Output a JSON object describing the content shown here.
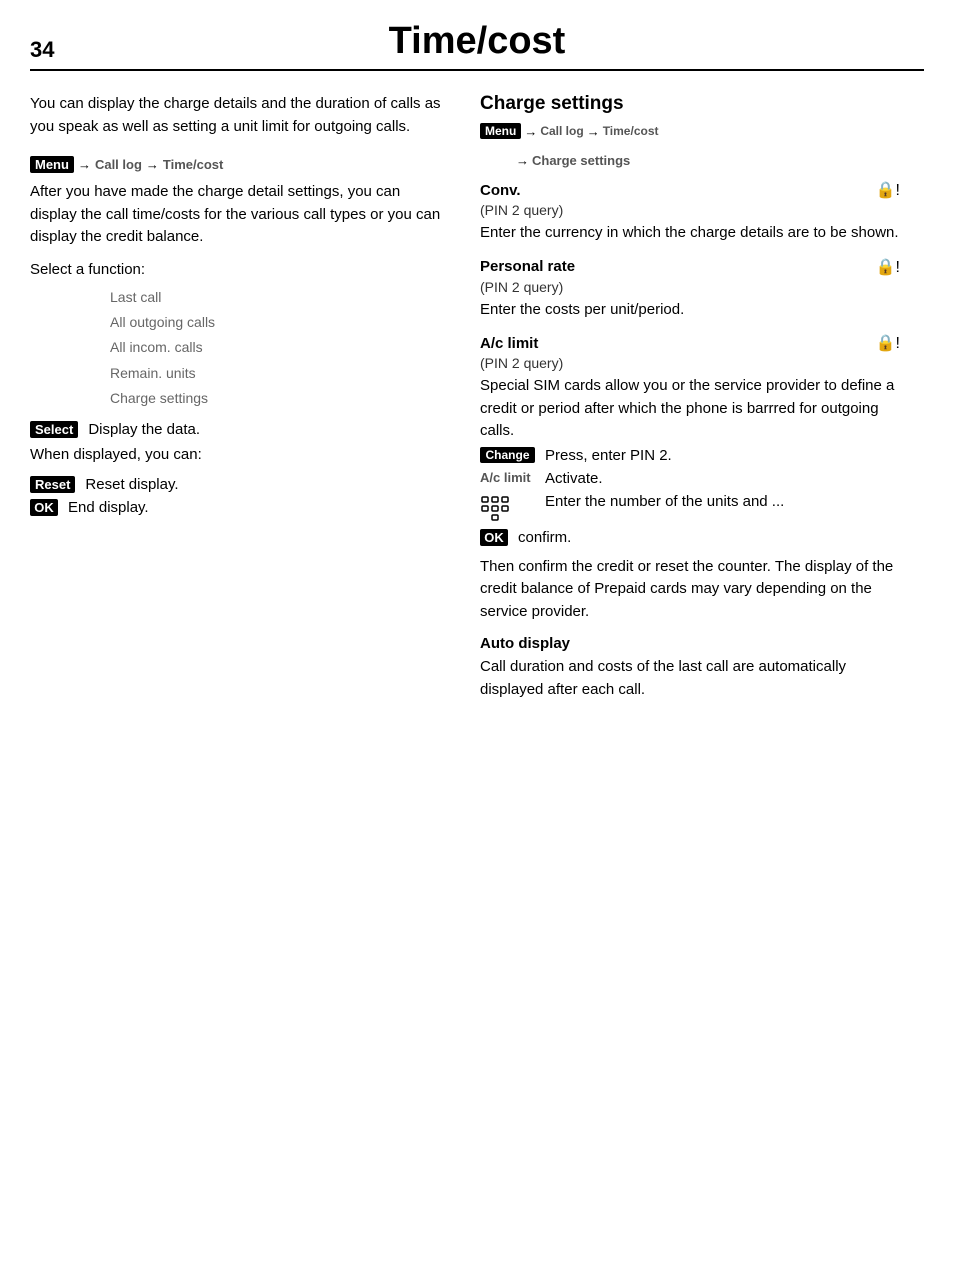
{
  "header": {
    "page_number": "34",
    "title": "Time/cost"
  },
  "left": {
    "intro": "You can display the charge details and the duration of calls as you speak as well as setting a unit limit for outgoing calls.",
    "nav": {
      "menu_label": "Menu",
      "arrow1": "→",
      "call_log": "Call log",
      "arrow2": "→",
      "time_cost": "Time/cost"
    },
    "after_text": "After you have made the charge detail settings, you can display the call time/costs for the various call types or you can display the credit balance.",
    "select_function": "Select a function:",
    "functions": [
      "Last call",
      "All outgoing calls",
      "All incom. calls",
      "Remain. units",
      "Charge settings"
    ],
    "select_btn": "Select",
    "select_action": "Display the data.",
    "when_displayed": "When displayed, you can:",
    "reset_btn": "Reset",
    "reset_action": "Reset display.",
    "ok_btn": "OK",
    "ok_action": "End display."
  },
  "right": {
    "charge_settings_title": "Charge settings",
    "nav": {
      "menu_label": "Menu",
      "arrow1": "→",
      "call_log": "Call log",
      "arrow2": "→",
      "time_cost": "Time/cost",
      "arrow3": "→",
      "charge_settings": "Charge settings"
    },
    "conv": {
      "title": "Conv.",
      "pin_query": "(PIN 2 query)",
      "text": "Enter the currency in which the charge details are to be shown.",
      "icon": "⊄!"
    },
    "personal_rate": {
      "title": "Personal rate",
      "pin_query": "(PIN 2 query)",
      "text": "Enter the costs per unit/period.",
      "icon": "⊄!"
    },
    "ac_limit": {
      "title": "A/c limit",
      "pin_query": "(PIN 2 query)",
      "text": "Special SIM cards allow you or the service provider to define a credit or period after which the phone is barrred for outgoing calls.",
      "icon": "⊄!",
      "change_btn": "Change",
      "change_action": "Press, enter PIN 2.",
      "ac_limit_label": "A/c limit",
      "ac_limit_action": "Activate.",
      "keypad_icon": "⌨",
      "enter_text": "Enter the number of the units and ...",
      "ok_btn": "OK",
      "ok_action": "confirm.",
      "then_text": "Then confirm the credit or reset the counter. The display of the credit balance of Prepaid cards may vary depending on the service provider."
    },
    "auto_display": {
      "title": "Auto display",
      "text": "Call duration and costs of the last call are automatically displayed after each call."
    }
  }
}
